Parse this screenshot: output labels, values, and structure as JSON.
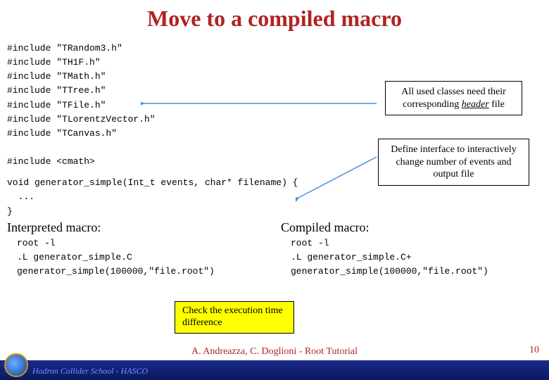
{
  "title": "Move to a compiled macro",
  "includes": [
    "#include \"TRandom3.h\"",
    "#include \"TH1F.h\"",
    "#include \"TMath.h\"",
    "#include \"TTree.h\"",
    "#include \"TFile.h\"",
    "#include \"TLorentzVector.h\"",
    "#include \"TCanvas.h\"",
    "",
    "#include <cmath>"
  ],
  "func_line": "void generator_simple(Int_t events, char* filename) {\n  ...\n}",
  "callout1": {
    "pre": "All used classes need their corresponding ",
    "em": "header",
    "post": " file"
  },
  "callout2": "Define interface to interactively change number of events and output file",
  "interpreted": {
    "heading": "Interpreted macro:",
    "lines": "root -l\n.L generator_simple.C\ngenerator_simple(100000,\"file.root\")"
  },
  "compiled": {
    "heading": "Compiled macro:",
    "lines": "root -l\n.L generator_simple.C+\ngenerator_simple(100000,\"file.root\")"
  },
  "yellow": "Check the execution time difference",
  "credit": "A. Andreazza, C. Doglioni - Root Tutorial",
  "footer_text": "Hadron Collider School - HASCO",
  "page": "10"
}
